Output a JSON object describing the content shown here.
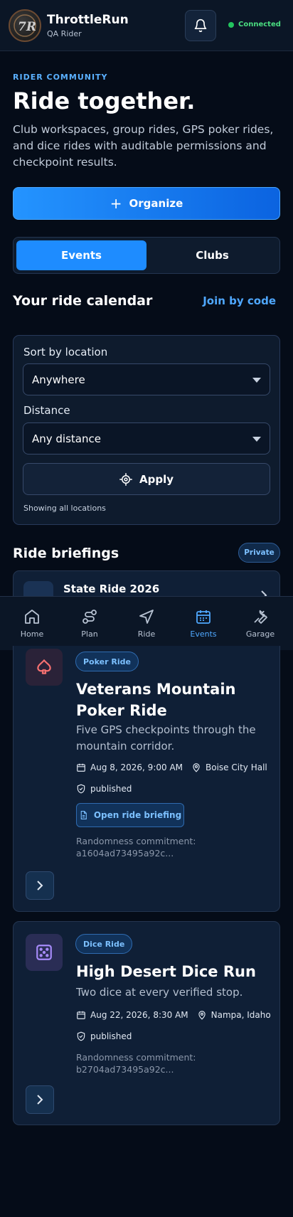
{
  "header": {
    "brand_title": "ThrottleRun",
    "brand_subtitle": "QA Rider",
    "status": "Connected",
    "status_color": "#22c55e"
  },
  "intro": {
    "eyebrow": "RIDER COMMUNITY",
    "title": "Ride together.",
    "description": "Club workspaces, group rides, GPS poker rides, and dice rides with auditable permissions and checkpoint results.",
    "organize_label": "Organize"
  },
  "segmented": {
    "tabs": [
      {
        "label": "Events",
        "active": true
      },
      {
        "label": "Clubs",
        "active": false
      }
    ]
  },
  "calendar": {
    "title": "Your ride calendar",
    "join_label": "Join by code"
  },
  "filters": {
    "location_label": "Sort by location",
    "location_value": "Anywhere",
    "distance_label": "Distance",
    "distance_value": "Any distance",
    "apply_label": "Apply",
    "showing_text": "Showing all locations"
  },
  "briefings": {
    "title": "Ride briefings",
    "badge": "Private",
    "peek_title": "State Ride 2026"
  },
  "nav": {
    "items": [
      {
        "label": "Home",
        "icon": "home-icon"
      },
      {
        "label": "Plan",
        "icon": "route-icon"
      },
      {
        "label": "Ride",
        "icon": "navigation-icon"
      },
      {
        "label": "Events",
        "icon": "calendar-icon",
        "active": true
      },
      {
        "label": "Garage",
        "icon": "wrench-icon"
      }
    ]
  },
  "events": [
    {
      "badge": "Poker Ride",
      "title": "Veterans Mountain Poker Ride",
      "description": "Five GPS checkpoints through the mountain corridor.",
      "date": "Aug 8, 2026, 9:00 AM",
      "location": "Boise City Hall",
      "status": "published",
      "briefing_label": "Open ride briefing",
      "commitment": "Randomness commitment: a1604ad73495a92c...",
      "icon": "spade-icon"
    },
    {
      "badge": "Dice Ride",
      "title": "High Desert Dice Run",
      "description": "Two dice at every verified stop.",
      "date": "Aug 22, 2026, 8:30 AM",
      "location": "Nampa, Idaho",
      "status": "published",
      "commitment": "Randomness commitment: b2704ad73495a92c...",
      "icon": "dice-icon"
    }
  ],
  "colors": {
    "accent": "#1e8cff",
    "background": "#050c18",
    "poker_icon": "#f87171",
    "dice_icon": "#a78bfa"
  }
}
